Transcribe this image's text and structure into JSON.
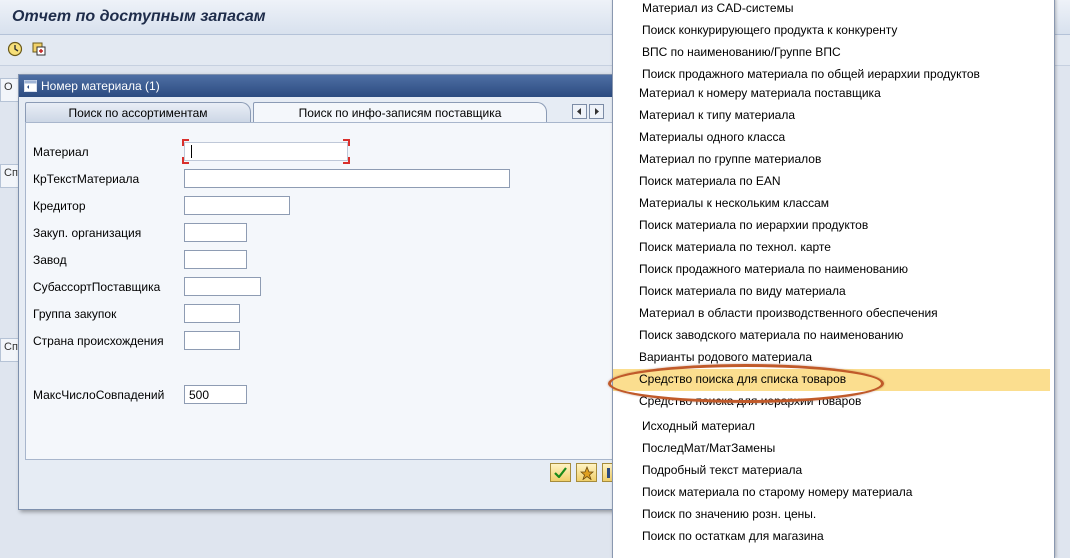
{
  "window": {
    "title": "Отчет по доступным запасам"
  },
  "toolbar": {
    "execute_icon": "execute-icon",
    "variant_icon": "get-variant-icon"
  },
  "dialog": {
    "title": "Номер материала (1)",
    "tabs": [
      "Поиск по ассортиментам",
      "Поиск по инфо-записям поставщика"
    ],
    "fields": [
      {
        "label": "Материал",
        "value": ""
      },
      {
        "label": "КрТекстМатериала",
        "value": ""
      },
      {
        "label": "Кредитор",
        "value": ""
      },
      {
        "label": "Закуп. организация",
        "value": ""
      },
      {
        "label": "Завод",
        "value": ""
      },
      {
        "label": "СубассортПоставщика",
        "value": ""
      },
      {
        "label": "Группа закупок",
        "value": ""
      },
      {
        "label": "Страна происхождения",
        "value": ""
      }
    ],
    "max_hits": {
      "label": "МаксЧислоСовпадений",
      "value": "500"
    }
  },
  "dropdown": {
    "items": [
      "Материал из CAD-системы",
      "Поиск конкурирующего продукта к конкуренту",
      "ВПС по наименованию/Группе ВПС",
      "Поиск продажного материала по общей иерархии продуктов",
      "Материал к номеру материала поставщика",
      "Материал к типу материала",
      "Материалы одного класса",
      "Материал по группе материалов",
      "Поиск материала по EAN",
      "Материалы к нескольким классам",
      "Поиск материала по иерархии продуктов",
      "Поиск материала по технол. карте",
      "Поиск продажного материала по наименованию",
      "Поиск материала по виду материала",
      "Материал в области производственного обеспечения",
      "Поиск заводского материала по наименованию",
      "Варианты родового материала",
      "Средство поиска для списка товаров",
      "Средство поиска для иерархии товаров",
      "Исходный материал",
      "ПоследМат/МатЗамены",
      "Подробный текст материала",
      "Поиск материала по старому номеру материала",
      "Поиск  по значению розн. цены.",
      "Поиск по остаткам для магазина"
    ],
    "selected": "Средство поиска для списка товаров"
  },
  "colors": {
    "highlight": "#fbde8f",
    "oval": "#c05a2a",
    "dialog_title": "#2c4b80"
  }
}
